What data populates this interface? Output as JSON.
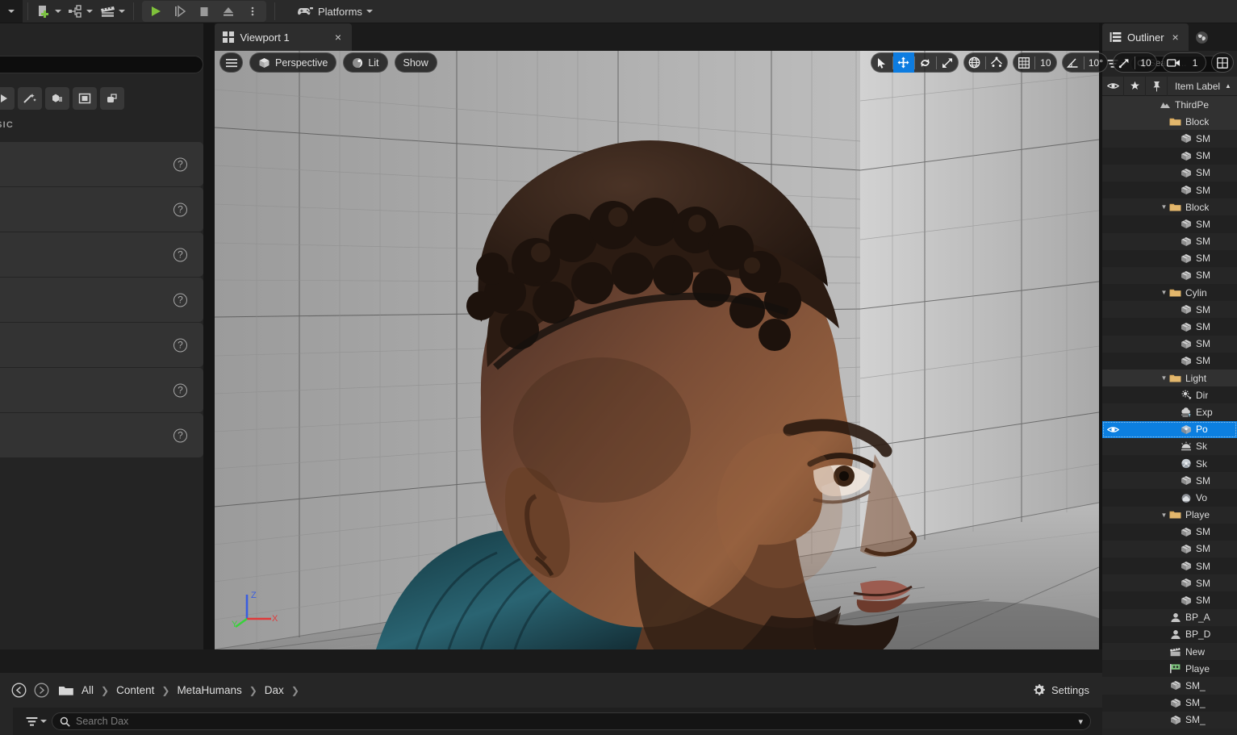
{
  "app": {
    "title": "Unreal Editor",
    "accent_blue": "#0c7fe0",
    "panel_bg": "#242424",
    "toolbar_bg": "#2a2a2a"
  },
  "topbar": {
    "items": [
      {
        "name": "add-actor",
        "label": "",
        "icon": "add-green-plus-icon",
        "has_chevron": true
      },
      {
        "name": "blueprints",
        "label": "",
        "icon": "blueprint-nodes-icon",
        "has_chevron": true
      },
      {
        "name": "cinematics",
        "label": "",
        "icon": "film-slate-icon",
        "has_chevron": true
      }
    ],
    "play_controls": [
      {
        "name": "play",
        "label": "Play",
        "icon": "play-triangle-icon",
        "color": "#7fc13b"
      },
      {
        "name": "skip",
        "label": "Skip",
        "icon": "step-forward-icon"
      },
      {
        "name": "stop",
        "label": "Stop",
        "icon": "stop-square-icon"
      },
      {
        "name": "eject",
        "label": "Eject",
        "icon": "eject-icon"
      },
      {
        "name": "more",
        "label": "More Options",
        "icon": "vertical-ellipsis-icon"
      }
    ],
    "platforms": {
      "label": "Platforms",
      "icon": "gamepad-icon"
    }
  },
  "place_actors": {
    "search_placeholder": "",
    "section_label": "ASIC",
    "tabs": [
      {
        "name": "recently-placed",
        "icon": "recently-placed-icon"
      },
      {
        "name": "favorites",
        "icon": "sparkle-wand-icon"
      },
      {
        "name": "basic",
        "icon": "basic-shapes-icon"
      },
      {
        "name": "lights",
        "icon": "square-outline-icon"
      },
      {
        "name": "shapes",
        "icon": "stacked-shapes-icon"
      }
    ],
    "rows": [
      {
        "label": "",
        "help": "?"
      },
      {
        "label": "",
        "help": "?"
      },
      {
        "label": "",
        "help": "?"
      },
      {
        "label": "",
        "help": "?"
      },
      {
        "label": "",
        "help": "?"
      },
      {
        "label": "",
        "help": "?"
      },
      {
        "label": "",
        "help": "?"
      }
    ]
  },
  "viewport": {
    "tab_label": "Viewport 1",
    "tab_close": "×",
    "menu_icon": "hamburger-menu-icon",
    "view_mode": {
      "label": "Perspective",
      "icon": "cube-icon"
    },
    "lighting_mode": {
      "label": "Lit",
      "icon": "sphere-lit-icon"
    },
    "show_menu": {
      "label": "Show"
    },
    "transform_tools": [
      {
        "name": "select",
        "icon": "cursor-arrow-icon",
        "active": false
      },
      {
        "name": "move",
        "icon": "move-arrows-icon",
        "active": true
      },
      {
        "name": "rotate",
        "icon": "rotate-arrows-icon",
        "active": false
      },
      {
        "name": "scale",
        "icon": "scale-arrows-icon",
        "active": false
      }
    ],
    "coord_tools": [
      {
        "name": "world-coordinates",
        "icon": "globe-icon"
      },
      {
        "name": "surface-snapping",
        "icon": "surface-snap-icon"
      }
    ],
    "snap_settings": [
      {
        "name": "grid-snap",
        "icon": "grid-icon",
        "value": "10"
      },
      {
        "name": "angle-snap",
        "icon": "angle-icon",
        "value": "10°"
      },
      {
        "name": "scale-snap",
        "icon": "diagonal-arrow-icon",
        "value": "10"
      },
      {
        "name": "camera-speed",
        "icon": "camera-icon",
        "value": "1"
      }
    ],
    "maximize": {
      "name": "maximize-viewport",
      "icon": "four-pane-icon"
    },
    "axis_gizmo": {
      "x_label": "X",
      "x_color": "#e03a3a",
      "y_label": "Y",
      "y_color": "#39d13b",
      "z_label": "Z",
      "z_color": "#3a5de0"
    },
    "scene": {
      "description": "MetaHuman character head in gray-tiled test room",
      "floor_color": "#b4b4b4",
      "wall_color": "#c6c6c6",
      "sky_color": "#6ea8e0"
    }
  },
  "outliner": {
    "tab_label": "Outliner",
    "tab_close": "×",
    "tab_icon": "outliner-list-icon",
    "world_tab_icon": "globe-world-icon",
    "filter_icon": "filter-funnel-icon",
    "filter_chevron": "chevron-down-icon",
    "search_placeholder": "Search...",
    "columns": [
      {
        "name": "visibility",
        "icon": "eye-icon"
      },
      {
        "name": "favorite",
        "icon": "star-icon"
      },
      {
        "name": "pin",
        "icon": "pin-icon"
      },
      {
        "name": "item-label",
        "label": "Item Label",
        "sort": "▲"
      }
    ],
    "rows": [
      {
        "label": "ThirdPe",
        "icon": "level-icon",
        "indent": 0,
        "twisty": "",
        "type": "level",
        "selected": false,
        "highlight": true
      },
      {
        "label": "Block",
        "icon": "folder-icon",
        "indent": 1,
        "twisty": "",
        "type": "folder",
        "selected": false,
        "highlight": true
      },
      {
        "label": "SM",
        "icon": "static-mesh-icon",
        "indent": 2,
        "twisty": "",
        "type": "mesh",
        "selected": false
      },
      {
        "label": "SM",
        "icon": "static-mesh-icon",
        "indent": 2,
        "twisty": "",
        "type": "mesh",
        "selected": false
      },
      {
        "label": "SM",
        "icon": "static-mesh-icon",
        "indent": 2,
        "twisty": "",
        "type": "mesh",
        "selected": false
      },
      {
        "label": "SM",
        "icon": "static-mesh-icon",
        "indent": 2,
        "twisty": "",
        "type": "mesh",
        "selected": false
      },
      {
        "label": "Block",
        "icon": "folder-icon",
        "indent": 1,
        "twisty": "▼",
        "type": "folder",
        "selected": false
      },
      {
        "label": "SM",
        "icon": "static-mesh-icon",
        "indent": 2,
        "twisty": "",
        "type": "mesh",
        "selected": false
      },
      {
        "label": "SM",
        "icon": "static-mesh-icon",
        "indent": 2,
        "twisty": "",
        "type": "mesh",
        "selected": false
      },
      {
        "label": "SM",
        "icon": "static-mesh-icon",
        "indent": 2,
        "twisty": "",
        "type": "mesh",
        "selected": false
      },
      {
        "label": "SM",
        "icon": "static-mesh-icon",
        "indent": 2,
        "twisty": "",
        "type": "mesh",
        "selected": false
      },
      {
        "label": "Cylin",
        "icon": "folder-icon",
        "indent": 1,
        "twisty": "▼",
        "type": "folder",
        "selected": false
      },
      {
        "label": "SM",
        "icon": "static-mesh-icon",
        "indent": 2,
        "twisty": "",
        "type": "mesh",
        "selected": false
      },
      {
        "label": "SM",
        "icon": "static-mesh-icon",
        "indent": 2,
        "twisty": "",
        "type": "mesh",
        "selected": false
      },
      {
        "label": "SM",
        "icon": "static-mesh-icon",
        "indent": 2,
        "twisty": "",
        "type": "mesh",
        "selected": false
      },
      {
        "label": "SM",
        "icon": "static-mesh-icon",
        "indent": 2,
        "twisty": "",
        "type": "mesh",
        "selected": false
      },
      {
        "label": "Light",
        "icon": "folder-icon",
        "indent": 1,
        "twisty": "▼",
        "type": "folder",
        "selected": false,
        "highlight": true
      },
      {
        "label": "Dir",
        "icon": "directional-light-icon",
        "indent": 2,
        "twisty": "",
        "type": "light",
        "selected": false
      },
      {
        "label": "Exp",
        "icon": "fog-icon",
        "indent": 2,
        "twisty": "",
        "type": "fog",
        "selected": false
      },
      {
        "label": "Po",
        "icon": "point-light-icon",
        "indent": 2,
        "twisty": "",
        "type": "light",
        "selected": true
      },
      {
        "label": "Sk",
        "icon": "sky-light-icon",
        "indent": 2,
        "twisty": "",
        "type": "light",
        "selected": false
      },
      {
        "label": "Sk",
        "icon": "sky-sphere-icon",
        "indent": 2,
        "twisty": "",
        "type": "mesh",
        "selected": false
      },
      {
        "label": "SM",
        "icon": "static-mesh-icon",
        "indent": 2,
        "twisty": "",
        "type": "mesh",
        "selected": false
      },
      {
        "label": "Vo",
        "icon": "volumetric-cloud-icon",
        "indent": 2,
        "twisty": "",
        "type": "cloud",
        "selected": false
      },
      {
        "label": "Playe",
        "icon": "folder-icon",
        "indent": 1,
        "twisty": "▼",
        "type": "folder",
        "selected": false
      },
      {
        "label": "SM",
        "icon": "static-mesh-icon",
        "indent": 2,
        "twisty": "",
        "type": "mesh",
        "selected": false
      },
      {
        "label": "SM",
        "icon": "static-mesh-icon",
        "indent": 2,
        "twisty": "",
        "type": "mesh",
        "selected": false
      },
      {
        "label": "SM",
        "icon": "static-mesh-icon",
        "indent": 2,
        "twisty": "",
        "type": "mesh",
        "selected": false
      },
      {
        "label": "SM",
        "icon": "static-mesh-icon",
        "indent": 2,
        "twisty": "",
        "type": "mesh",
        "selected": false
      },
      {
        "label": "SM",
        "icon": "static-mesh-icon",
        "indent": 2,
        "twisty": "",
        "type": "mesh",
        "selected": false
      },
      {
        "label": "BP_A",
        "icon": "blueprint-actor-icon",
        "indent": 1,
        "twisty": "",
        "type": "bp",
        "selected": false
      },
      {
        "label": "BP_D",
        "icon": "blueprint-actor-icon",
        "indent": 1,
        "twisty": "",
        "type": "bp",
        "selected": false
      },
      {
        "label": "New",
        "icon": "film-slate-icon",
        "indent": 1,
        "twisty": "",
        "type": "sequence",
        "selected": false
      },
      {
        "label": "Playe",
        "icon": "player-start-icon",
        "indent": 1,
        "twisty": "",
        "type": "playerstart",
        "selected": false
      },
      {
        "label": "SM_",
        "icon": "static-mesh-icon",
        "indent": 1,
        "twisty": "",
        "type": "mesh",
        "selected": false
      },
      {
        "label": "SM_",
        "icon": "static-mesh-icon",
        "indent": 1,
        "twisty": "",
        "type": "mesh",
        "selected": false
      },
      {
        "label": "SM_",
        "icon": "static-mesh-icon",
        "indent": 1,
        "twisty": "",
        "type": "mesh",
        "selected": false
      }
    ]
  },
  "content_browser": {
    "nav_back": {
      "name": "back-button",
      "icon": "arrow-left-circle-icon"
    },
    "nav_forward": {
      "name": "forward-button",
      "icon": "arrow-right-circle-icon"
    },
    "root_icon": "folder-icon",
    "breadcrumb": [
      "All",
      "Content",
      "MetaHumans",
      "Dax"
    ],
    "breadcrumb_separator": "❯",
    "settings": {
      "label": "Settings",
      "icon": "gear-icon"
    },
    "filter_icon": "filter-funnel-icon",
    "filter_chevron": "chevron-down-icon",
    "search_placeholder": "Search Dax",
    "search_value": "",
    "search_dropdown": "chevron-down-icon"
  }
}
